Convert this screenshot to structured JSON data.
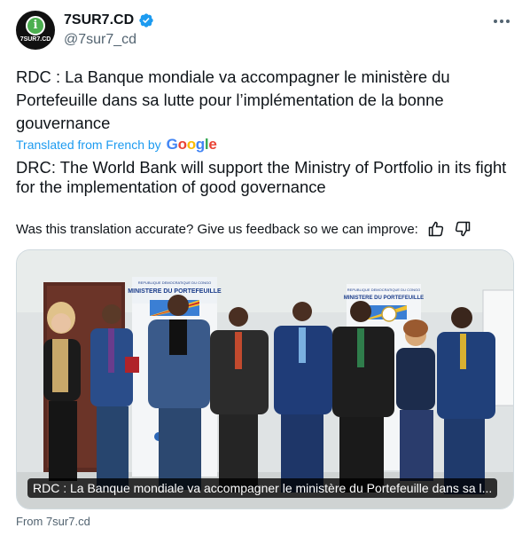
{
  "account": {
    "display_name": "7SUR7.CD",
    "handle": "@7sur7_cd",
    "avatar_text": "7SUR7.CD",
    "verified": true
  },
  "tweet": {
    "original_text": "RDC : La Banque mondiale va accompagner le ministère du Portefeuille dans sa lutte pour l’implémentation de la bonne gouvernance",
    "translated_label": "Translated from French by",
    "translator": "Google",
    "translated_text": "DRC: The World Bank will support the Ministry of Portfolio in its fight for the implementation of good governance",
    "feedback_prompt": "Was this translation accurate? Give us feedback so we can improve:"
  },
  "media": {
    "caption": "RDC : La Banque mondiale va accompagner le ministère du Portefeuille dans sa l...",
    "banner_left": {
      "line1": "REPUBLIQUE DEMOCRATIQUE DU CONGO",
      "line2": "MINISTERE DU PORTEFEUILLE"
    },
    "banner_right": {
      "line1": "REPUBLIQUE DEMOCRATIQUE DU CONGO",
      "line2": "MINISTERE DU PORTEFEUILLE"
    }
  },
  "card_source": "From 7sur7.cd",
  "icons": {
    "more": "more-horizontal-icon",
    "verified": "verified-badge-icon",
    "thumbs_up": "thumbs-up-icon",
    "thumbs_down": "thumbs-down-icon"
  },
  "colors": {
    "accent": "#1d9bf0",
    "text": "#0f1419",
    "secondary": "#536471"
  }
}
